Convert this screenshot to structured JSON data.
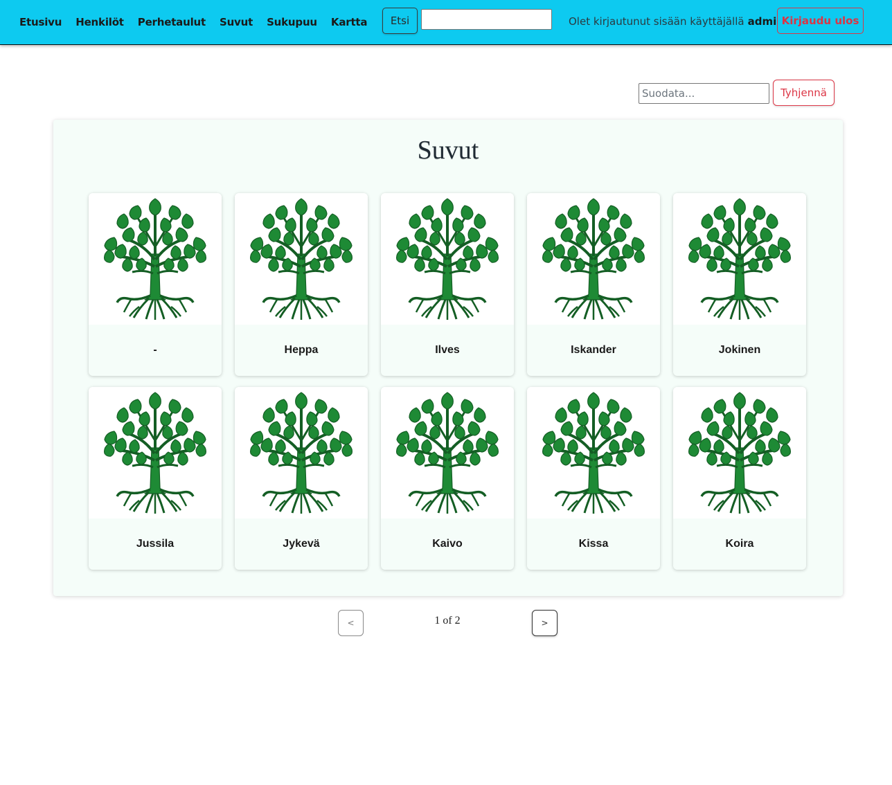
{
  "navbar": {
    "links": [
      "Etusivu",
      "Henkilöt",
      "Perhetaulut",
      "Suvut",
      "Sukupuu",
      "Kartta"
    ],
    "search_button": "Etsi",
    "search_value": "",
    "login_text": "Olet kirjautunut sisään käyttäjällä",
    "username": "admin",
    "logout_button": "Kirjaudu ulos"
  },
  "filter": {
    "placeholder": "Suodata...",
    "value": "",
    "clear_button": "Tyhjennä"
  },
  "panel": {
    "title": "Suvut",
    "icon": "tree-coat-of-arms-icon",
    "families": [
      "-",
      "Heppa",
      "Ilves",
      "Iskander",
      "Jokinen",
      "Jussila",
      "Jykevä",
      "Kaivo",
      "Kissa",
      "Koira"
    ]
  },
  "pagination": {
    "prev": "<",
    "next": ">",
    "current": "1",
    "of_label": "of",
    "total": "2",
    "info": "1  of 2"
  },
  "colors": {
    "navbar": "#0dcaf0",
    "danger": "#dc3545",
    "tree_green": "#1e8a35",
    "panel_bg": "#f5fdf9"
  }
}
